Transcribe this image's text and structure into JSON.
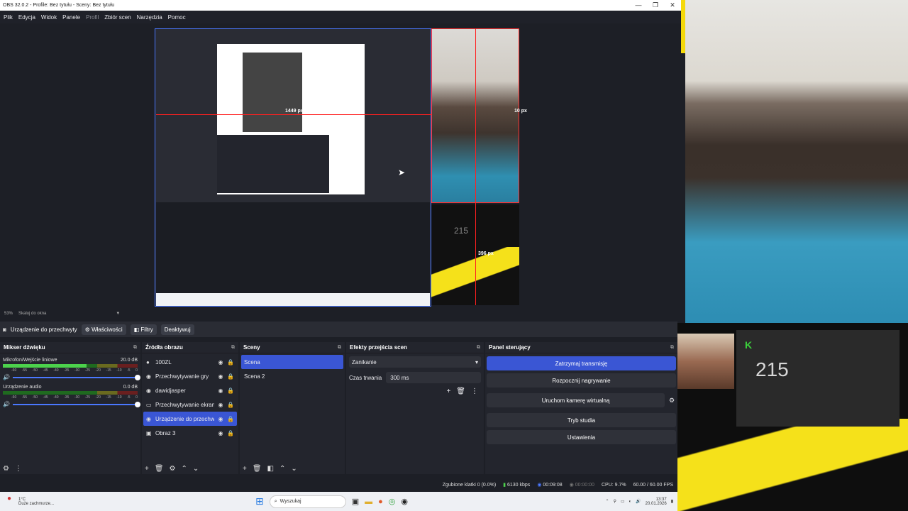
{
  "window": {
    "title": "OBS 32.0.2 - Profile: Bez tytułu - Sceny: Bez tytułu",
    "controls": [
      "—",
      "❐",
      "✕"
    ]
  },
  "menu": {
    "items": [
      "Plik",
      "Edycja",
      "Widok",
      "Panele",
      "Profil",
      "Zbiór scen",
      "Narzędzia",
      "Pomoc"
    ]
  },
  "preview": {
    "label_width": "1449 px",
    "label_right": "10 px",
    "label_height": "396 px",
    "overlay_count": "215"
  },
  "zoom": {
    "value": "53%",
    "fit_label": "Skaluj do okna"
  },
  "source_toolbar": {
    "source_name": "Urządzenie do przechwyty",
    "properties": "Właściwości",
    "filters": "Filtry",
    "deactivate": "Deaktywuj"
  },
  "mixer": {
    "title": "Mikser dźwięku",
    "channels": [
      {
        "name": "Mikrofon/Wejście liniowe",
        "db": "20.0 dB",
        "level": 0.62
      },
      {
        "name": "Urządzenie audio",
        "db": "0.0 dB",
        "level": 0.0
      }
    ],
    "ticks": [
      "-60",
      "-55",
      "-50",
      "-45",
      "-40",
      "-35",
      "-30",
      "-25",
      "-20",
      "-15",
      "-10",
      "-5",
      "0"
    ]
  },
  "sources": {
    "title": "Źródła obrazu",
    "items": [
      {
        "label": "100ZL",
        "icon": "●"
      },
      {
        "label": "Przechwytywanie gry",
        "icon": "◉"
      },
      {
        "label": "dawidjasper",
        "icon": "◉"
      },
      {
        "label": "Przechwytywanie ekranu",
        "icon": "▭"
      },
      {
        "label": "Urządzenie do przechwytywar",
        "icon": "◉",
        "selected": true
      },
      {
        "label": "Obraz 3",
        "icon": "▣"
      }
    ]
  },
  "scenes": {
    "title": "Sceny",
    "items": [
      {
        "label": "Scena",
        "selected": true
      },
      {
        "label": "Scena 2"
      }
    ]
  },
  "transitions": {
    "title": "Efekty przejścia scen",
    "selected": "Zanikanie",
    "duration_label": "Czas trwania",
    "duration_value": "300 ms"
  },
  "controls": {
    "title": "Panel sterujący",
    "buttons": [
      "Zatrzymaj transmisję",
      "Rozpocznij nagrywanie",
      "Uruchom kamerę wirtualną",
      "Tryb studia",
      "Ustawienia"
    ]
  },
  "status": {
    "dropped": "Zgubione klatki 0 (0.0%)",
    "bitrate": "6130 kbps",
    "stream_time": "00:09:08",
    "rec_time": "00:00:00",
    "cpu": "CPU: 9.7%",
    "fps": "60.00 / 60.00 FPS"
  },
  "taskbar": {
    "temp": "1°C",
    "weather": "Duże zachmurze...",
    "search_placeholder": "Wyszukaj",
    "time": "13:37",
    "date": "20.01.2026"
  },
  "overlay": {
    "count": "215"
  },
  "colors": {
    "accent": "#3a56d4",
    "preview_border": "#4a78ff",
    "guide": "#ff2020",
    "overlay_yellow": "#f5e11a"
  }
}
